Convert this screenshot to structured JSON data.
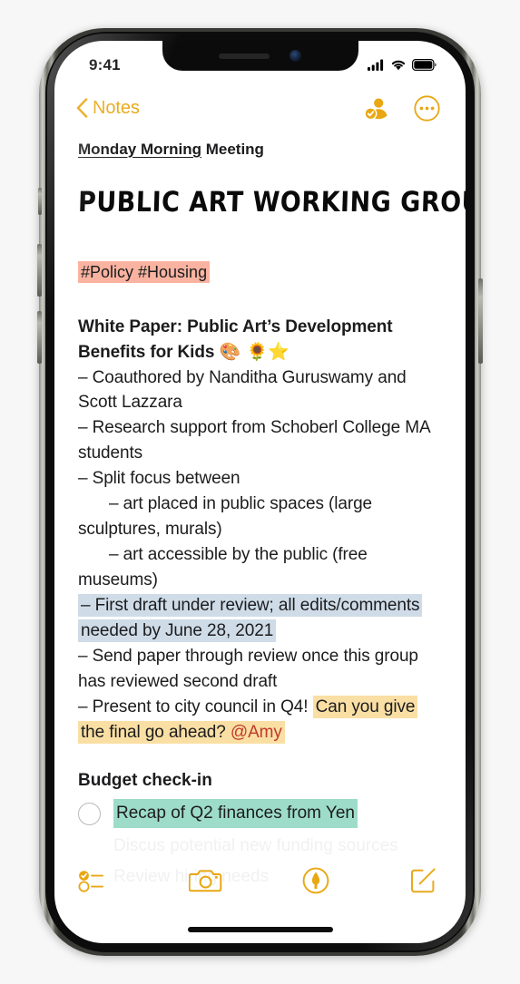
{
  "status_bar": {
    "time": "9:41",
    "icons": [
      "cellular-signal-icon",
      "wifi-icon",
      "battery-icon"
    ]
  },
  "nav_bar": {
    "back_label": "Notes",
    "back_icon": "chevron-left-icon",
    "collaborate_icon": "person-check-badge-icon",
    "more_icon": "more-circle-icon",
    "accent_color": "#E8A713"
  },
  "note": {
    "subtitle_underlined": "Monday Morning",
    "subtitle_rest": " Meeting",
    "title": "PUBLIC ART WORKING GROUP",
    "tags": "#Policy #Housing",
    "heading_line1": "White Paper: Public Art’s Development",
    "heading_line2": "Benefits for Kids ",
    "heading_emoji": "🎨 🌻⭐",
    "bullets": [
      "– Coauthored by Nanditha Guruswamy and Scott Lazzara",
      "– Research support from Schoberl College MA students",
      "– Split focus between"
    ],
    "sub_bullets": [
      "– art placed in public spaces (large sculptures, murals)",
      "– art accessible by the public (free museums)"
    ],
    "highlight_blue": "– First draft under review; all edits/comments needed by June 28, 2021",
    "bullet_send": "– Send paper through review once this group has reviewed second draft",
    "bullet_present_plain": "– Present to city council in Q4! ",
    "bullet_present_highlight": "Can you give the final go ahead? ",
    "mention": "@Amy",
    "section_heading": "Budget check-in",
    "checklist": [
      {
        "label": "Recap of Q2 finances from Yen",
        "checked": false,
        "highlight": "mint"
      }
    ],
    "faded_lines": [
      "Discus potential new funding sources",
      "Review hiring needs"
    ],
    "highlight_colors": {
      "pink": "#F9B3A0",
      "blue": "#CFDCE8",
      "amber": "#FADFA4",
      "mint": "#9DDCC8",
      "mention_red": "#C0392B"
    }
  },
  "toolbar": {
    "items": [
      {
        "name": "checklist-icon"
      },
      {
        "name": "camera-icon"
      },
      {
        "name": "markup-pen-icon"
      },
      {
        "name": "compose-icon"
      }
    ]
  }
}
